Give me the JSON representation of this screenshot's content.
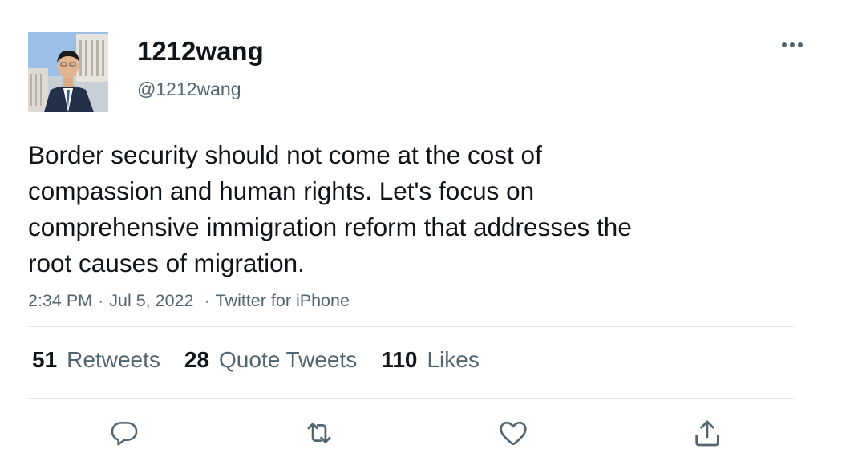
{
  "user": {
    "display_name": "1212wang",
    "handle": "@1212wang"
  },
  "tweet": {
    "lines": [
      "Border security should not come at the cost of",
      "compassion and human rights. Let's focus on",
      "comprehensive immigration reform that addresses the",
      "root causes of migration."
    ],
    "time": "2:34 PM",
    "date": "Jul 5, 2022",
    "source": "Twitter for iPhone",
    "separator": "·"
  },
  "stats": [
    {
      "count": "51",
      "label": "Retweets"
    },
    {
      "count": "28",
      "label": "Quote Tweets"
    },
    {
      "count": "110",
      "label": "Likes"
    }
  ],
  "actions": [
    "reply-icon",
    "retweet-icon",
    "like-icon",
    "share-icon"
  ],
  "colors": {
    "text": "#0f1419",
    "secondary": "#536471",
    "divider": "#e4e8ea"
  }
}
